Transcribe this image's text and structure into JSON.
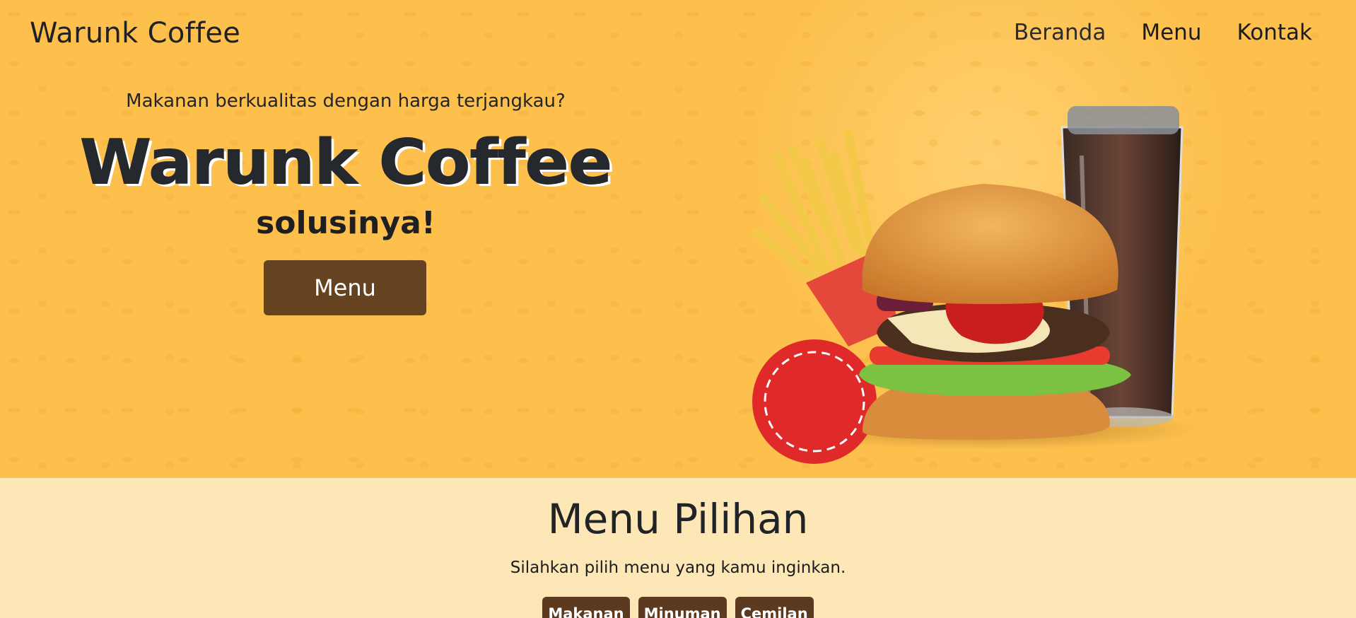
{
  "navbar": {
    "brand": "Warunk Coffee",
    "links": [
      "Beranda",
      "Menu",
      "Kontak"
    ]
  },
  "hero": {
    "tagline": "Makanan berkualitas dengan harga terjangkau?",
    "title": "Warunk Coffee",
    "subtitle": "solusinya!",
    "button_label": "Menu"
  },
  "menu_section": {
    "title": "Menu Pilihan",
    "description": "Silahkan pilih menu yang kamu inginkan.",
    "tabs": [
      "Makanan",
      "Minuman",
      "Cemilan"
    ]
  },
  "colors": {
    "hero_background": "#fdc04d",
    "section_background": "#fee7b6",
    "button": "#654321",
    "tab": "#5b3a1f"
  }
}
